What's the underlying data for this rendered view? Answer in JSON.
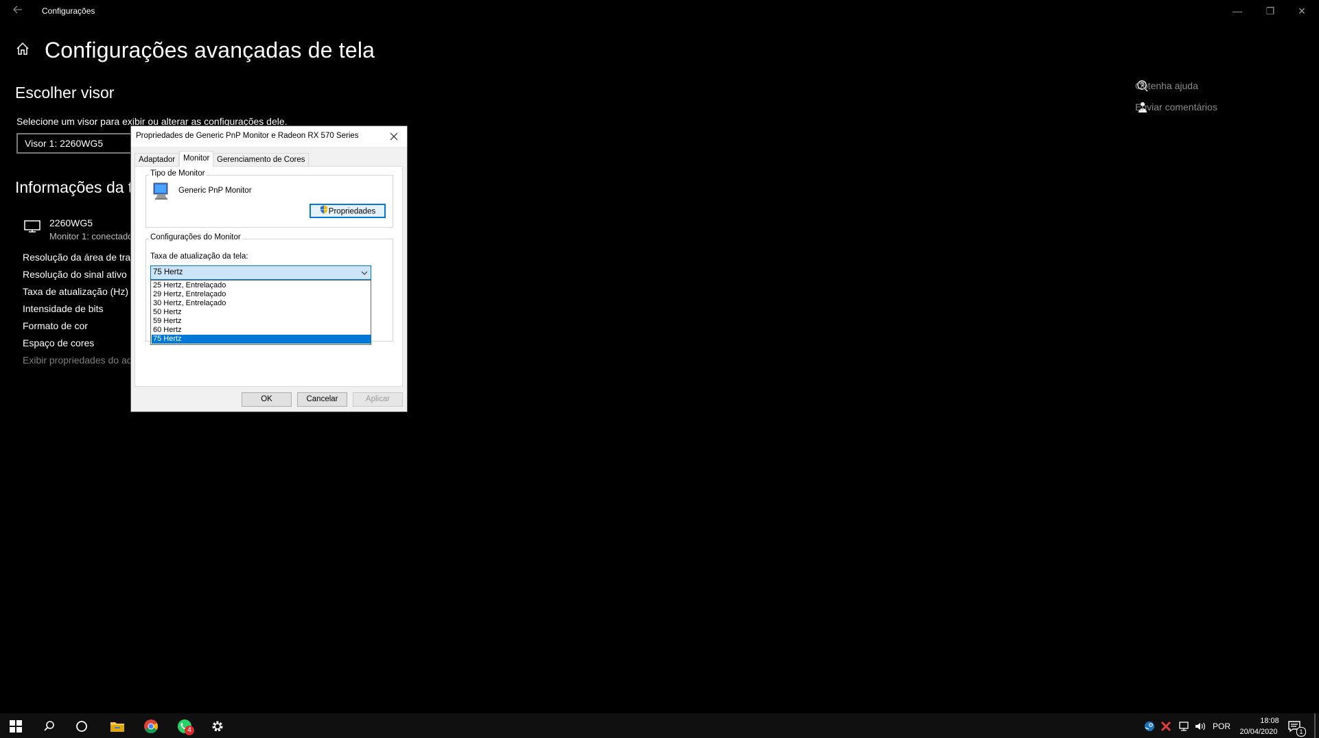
{
  "window": {
    "title": "Configurações",
    "back_icon": "back-arrow-icon",
    "controls": {
      "minimize": "—",
      "restore": "❐",
      "close": "✕"
    }
  },
  "page": {
    "title": "Configurações avançadas de tela",
    "choose_display": {
      "heading": "Escolher visor",
      "description": "Selecione um visor para exibir ou alterar as configurações dele.",
      "selected": "Visor 1: 2260WG5"
    },
    "display_info": {
      "heading": "Informações da tela",
      "monitor_name": "2260WG5",
      "monitor_status": "Monitor 1: conectado",
      "rows": [
        "Resolução da área de trabalho",
        "Resolução do sinal ativo",
        "Taxa de atualização (Hz)",
        "Intensidade de bits",
        "Formato de cor",
        "Espaço de cores"
      ],
      "adapter_link": "Exibir propriedades do adaptador"
    }
  },
  "help": {
    "get_help": "Obtenha ajuda",
    "send_feedback": "Enviar comentários"
  },
  "dialog": {
    "title": "Propriedades de Generic PnP Monitor e Radeon RX 570 Series",
    "tabs": [
      "Adaptador",
      "Monitor",
      "Gerenciamento de Cores"
    ],
    "active_tab": "Monitor",
    "monitor_type": {
      "label": "Tipo de Monitor",
      "name": "Generic PnP Monitor",
      "properties_button": "Propriedades"
    },
    "monitor_settings": {
      "label": "Configurações do Monitor",
      "refresh_label": "Taxa de atualização da tela:",
      "selected_rate": "75 Hertz",
      "options": [
        "25 Hertz, Entrelaçado",
        "29 Hertz, Entrelaçado",
        "30 Hertz, Entrelaçado",
        "50 Hertz",
        "59 Hertz",
        "60 Hertz",
        "75 Hertz"
      ],
      "selected_index": 6
    },
    "buttons": {
      "ok": "OK",
      "cancel": "Cancelar",
      "apply": "Aplicar"
    }
  },
  "taskbar": {
    "pinned": [
      "windows-start-icon",
      "search-icon",
      "cortana-icon",
      "file-explorer-icon",
      "chrome-icon",
      "whatsapp-icon",
      "settings-gear-icon"
    ],
    "whatsapp_badge": "4",
    "language": "POR",
    "time": "18:08",
    "date": "20/04/2020",
    "notifications_count": "1"
  },
  "colors": {
    "background": "#000000",
    "accent": "#0078d7",
    "dialog_bg": "#f0f0f0",
    "taskbar": "#101010"
  }
}
